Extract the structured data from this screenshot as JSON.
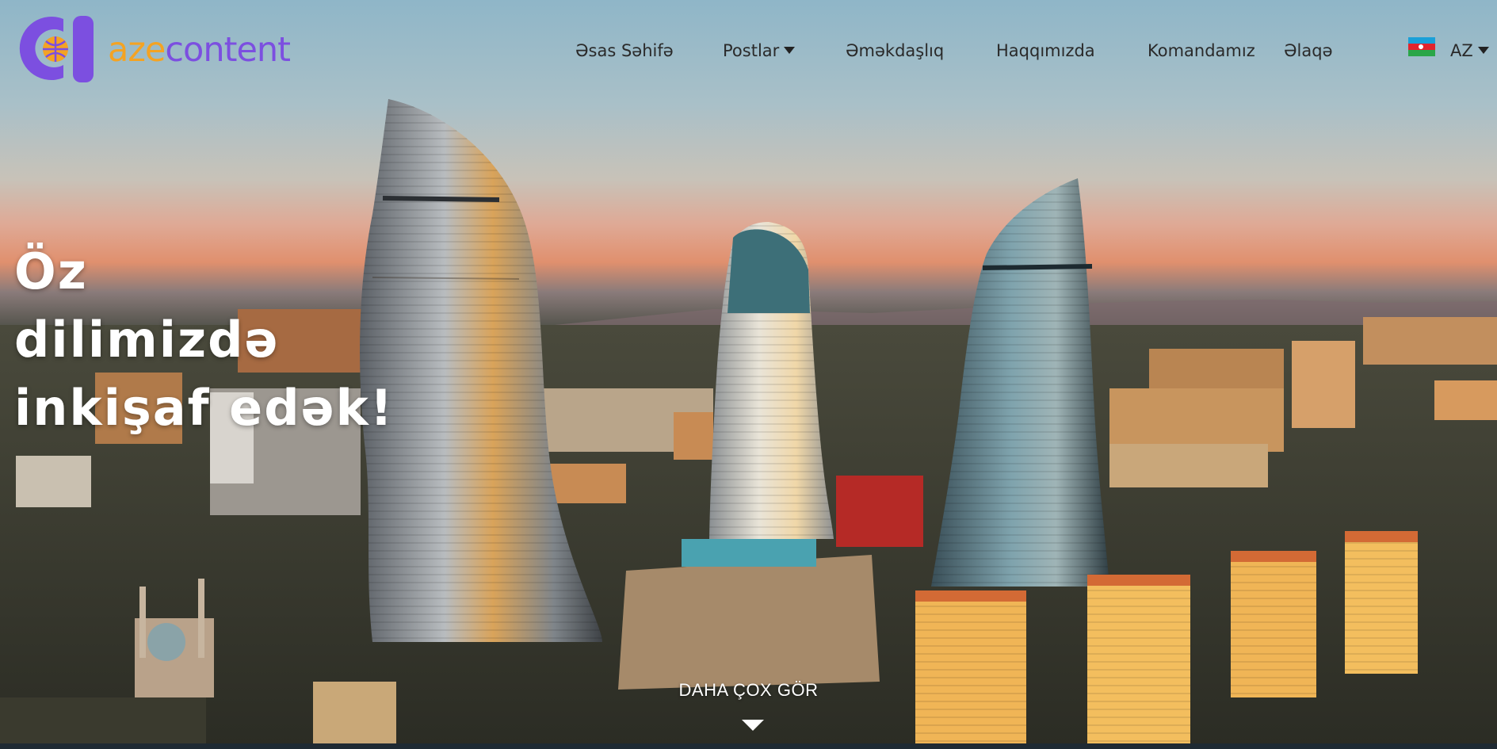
{
  "brand": {
    "aze": "aze",
    "content": "content",
    "colors": {
      "orange": "#f4a323",
      "purple": "#7c4fe0"
    }
  },
  "nav": {
    "items": [
      {
        "label": "Əsas Səhifə"
      },
      {
        "label": "Postlar"
      },
      {
        "label": "Əməkdaşlıq"
      },
      {
        "label": "Haqqımızda"
      },
      {
        "label": "Komandamız"
      },
      {
        "label": "Əlaqə"
      }
    ],
    "language": "AZ",
    "flag_icon": "azerbaijan-flag-icon"
  },
  "hero": {
    "headline_lines": [
      "Öz",
      "dilimizdə",
      "inkişaf edək!"
    ],
    "cta": "DAHA ÇOX GÖR"
  }
}
